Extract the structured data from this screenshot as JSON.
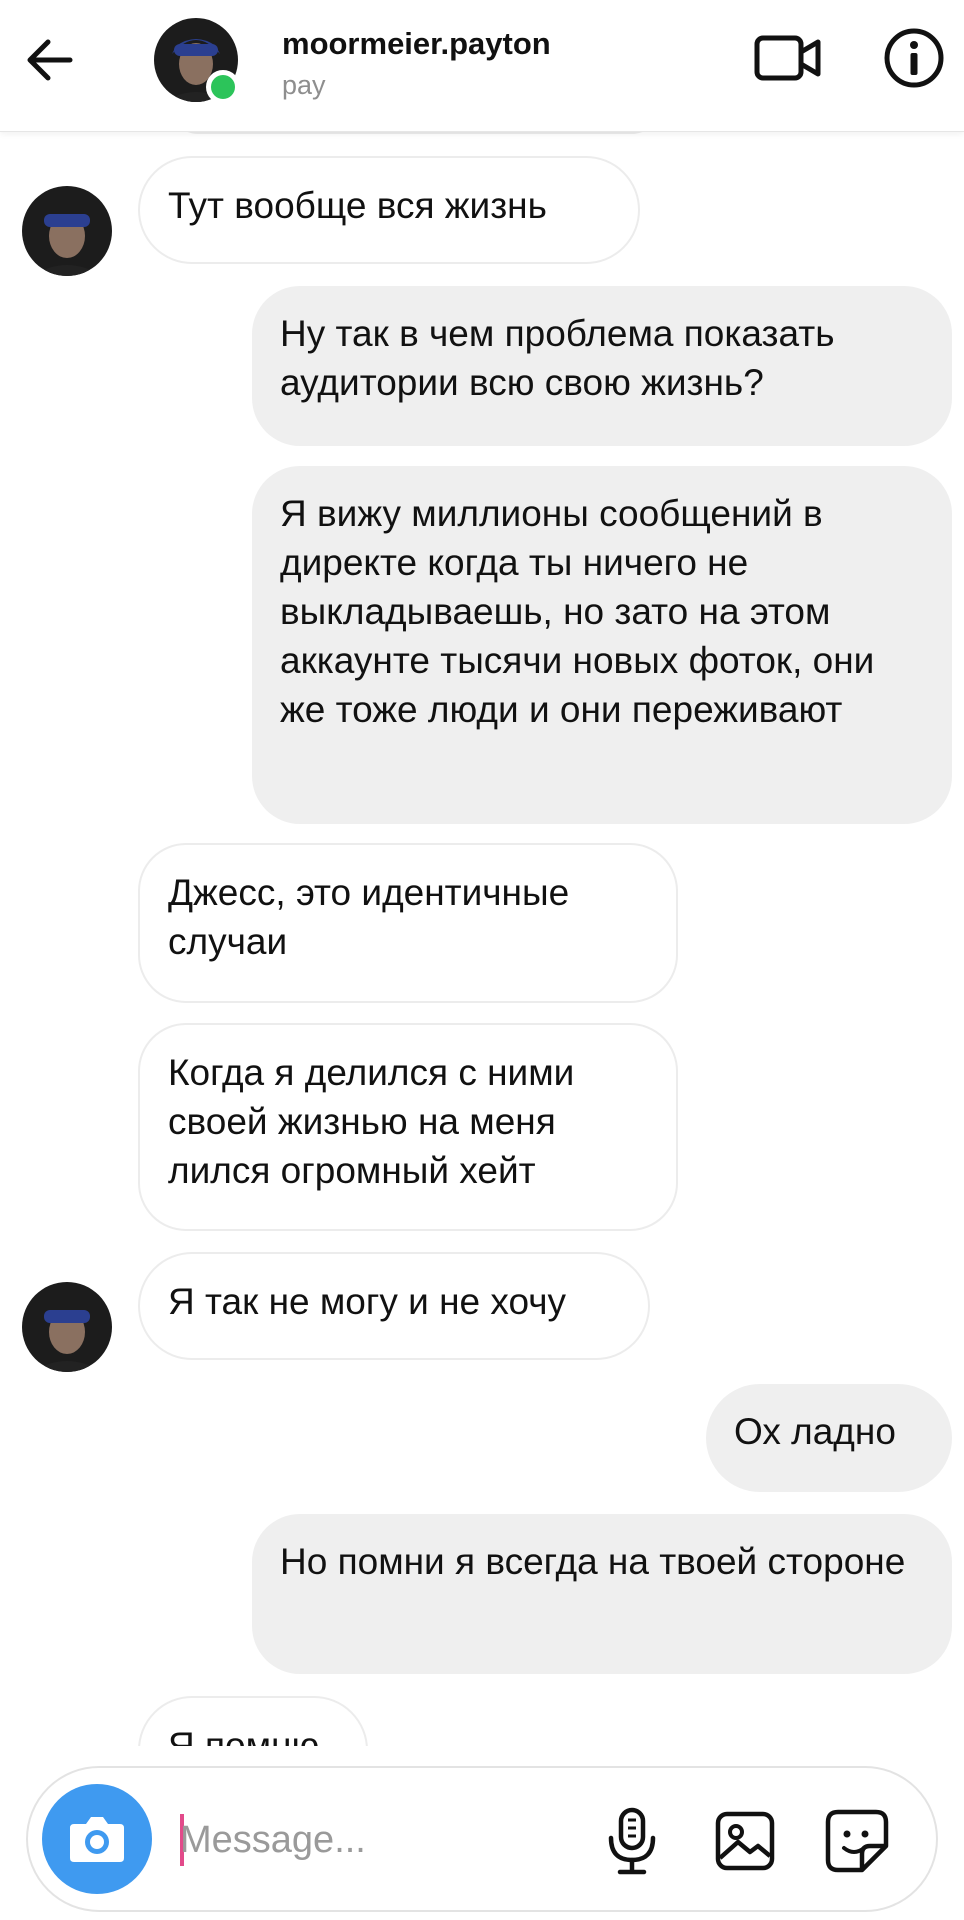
{
  "header": {
    "username": "moormeier.payton",
    "subtitle": "pay"
  },
  "messages": [
    {
      "side": "in",
      "text": "Тут вообще вся жизнь"
    },
    {
      "side": "out",
      "text": "Ну так в чем проблема показать аудитории всю свою жизнь?"
    },
    {
      "side": "out",
      "text": "Я вижу миллионы сообщений в директе когда ты ничего не выкладываешь, но зато на этом аккаунте тысячи новых фоток, они же тоже люди и они переживают"
    },
    {
      "side": "in",
      "text": "Джесс, это идентичные случаи"
    },
    {
      "side": "in",
      "text": "Когда я делился с ними своей жизнью на меня лился огромный хейт"
    },
    {
      "side": "in",
      "text": "Я так не могу и не хочу"
    },
    {
      "side": "out",
      "text": "Ох ладно"
    },
    {
      "side": "out",
      "text": "Но помни я всегда на твоей стороне"
    },
    {
      "side": "in",
      "text": "Я помню"
    }
  ],
  "composer": {
    "placeholder": "Message..."
  },
  "colors": {
    "accent_blue": "#3f9af0",
    "online_green": "#2cc45a",
    "outgoing_bubble": "#efefef",
    "caret": "#e24a8a"
  },
  "icons": [
    "back-arrow-icon",
    "video-call-icon",
    "info-icon",
    "camera-icon",
    "microphone-icon",
    "gallery-icon",
    "sticker-icon"
  ]
}
